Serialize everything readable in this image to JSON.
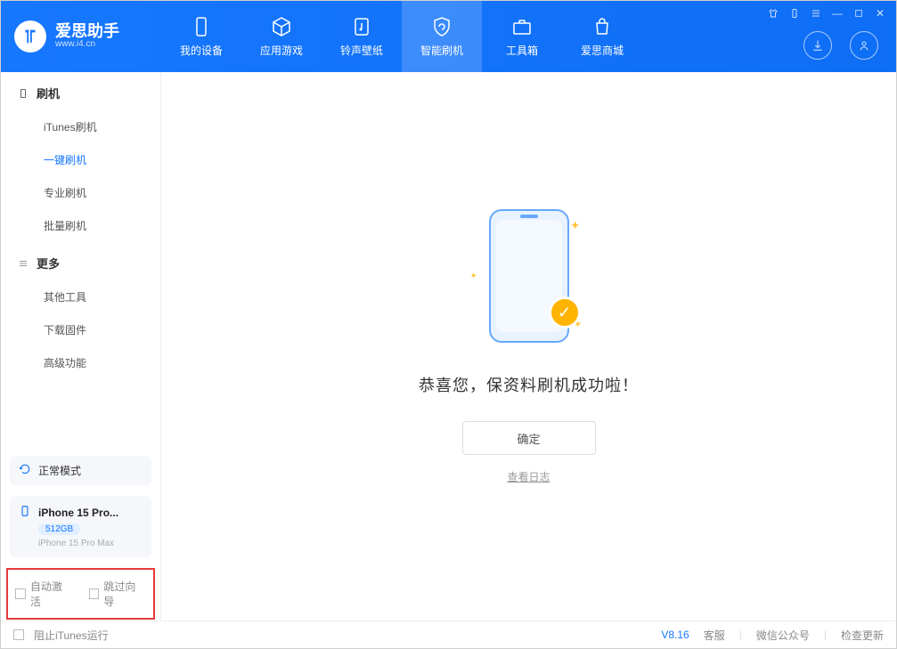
{
  "app": {
    "title": "爱思助手",
    "subtitle": "www.i4.cn"
  },
  "nav": [
    {
      "label": "我的设备"
    },
    {
      "label": "应用游戏"
    },
    {
      "label": "铃声壁纸"
    },
    {
      "label": "智能刷机"
    },
    {
      "label": "工具箱"
    },
    {
      "label": "爱思商城"
    }
  ],
  "sidebar": {
    "section1": {
      "title": "刷机",
      "items": [
        "iTunes刷机",
        "一键刷机",
        "专业刷机",
        "批量刷机"
      ]
    },
    "section2": {
      "title": "更多",
      "items": [
        "其他工具",
        "下载固件",
        "高级功能"
      ]
    },
    "mode": "正常模式",
    "device": {
      "name": "iPhone 15 Pro...",
      "storage": "512GB",
      "full": "iPhone 15 Pro Max"
    },
    "checks": {
      "auto": "自动激活",
      "skip": "跳过向导"
    }
  },
  "main": {
    "success": "恭喜您，保资料刷机成功啦！",
    "ok": "确定",
    "log": "查看日志"
  },
  "footer": {
    "block": "阻止iTunes运行",
    "version": "V8.16",
    "links": [
      "客服",
      "微信公众号",
      "检查更新"
    ]
  }
}
